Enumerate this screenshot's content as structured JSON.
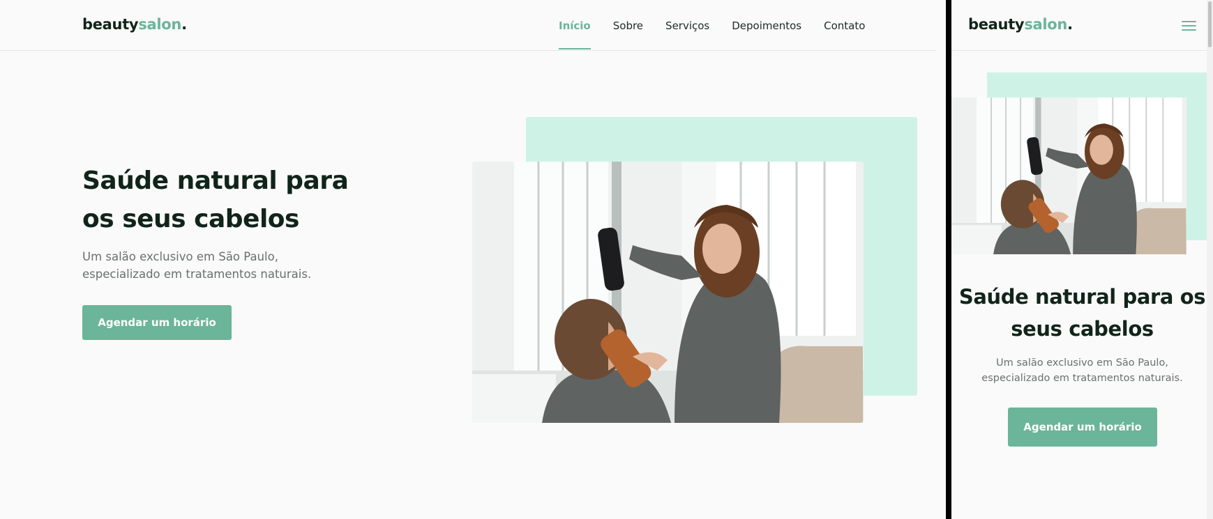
{
  "brand": {
    "name": "beauty",
    "accent": "salon",
    "dot": ".",
    "accent_color": "#6bb59a"
  },
  "nav": {
    "items": [
      {
        "label": "Início",
        "active": true
      },
      {
        "label": "Sobre",
        "active": false
      },
      {
        "label": "Serviços",
        "active": false
      },
      {
        "label": "Depoimentos",
        "active": false
      },
      {
        "label": "Contato",
        "active": false
      }
    ]
  },
  "hero": {
    "title": "Saúde natural para os seus cabelos",
    "subtitle": "Um salão exclusivo em São Paulo, especializado em tratamentos naturais.",
    "cta_label": "Agendar um horário",
    "image_alt": "hairdresser-drying-client-hair-photo",
    "mint_color": "#cef3e6"
  },
  "mobile": {
    "menu_icon": "hamburger-menu-icon"
  }
}
